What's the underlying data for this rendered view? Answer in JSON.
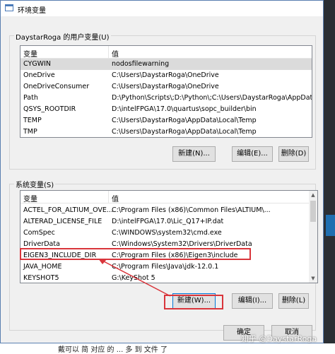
{
  "window": {
    "title": "环境变量"
  },
  "user_group": {
    "label": "DaystarRoga 的用户变量(U)",
    "columns": [
      "变量",
      "值"
    ],
    "rows": [
      {
        "name": "CYGWIN",
        "value": "nodosfilewarning"
      },
      {
        "name": "OneDrive",
        "value": "C:\\Users\\DaystarRoga\\OneDrive"
      },
      {
        "name": "OneDriveConsumer",
        "value": "C:\\Users\\DaystarRoga\\OneDrive"
      },
      {
        "name": "Path",
        "value": "D:\\Python\\Scripts\\;D:\\Python\\;C:\\Users\\DaystarRoga\\AppData..."
      },
      {
        "name": "QSYS_ROOTDIR",
        "value": "D:\\intelFPGA\\17.0\\quartus\\sopc_builder\\bin"
      },
      {
        "name": "TEMP",
        "value": "C:\\Users\\DaystarRoga\\AppData\\Local\\Temp"
      },
      {
        "name": "TMP",
        "value": "C:\\Users\\DaystarRoga\\AppData\\Local\\Temp"
      }
    ],
    "buttons": {
      "new": "新建(N)...",
      "edit": "编辑(E)...",
      "delete": "删除(D)"
    }
  },
  "system_group": {
    "label": "系统变量(S)",
    "columns": [
      "变量",
      "值"
    ],
    "rows": [
      {
        "name": "ACTEL_FOR_ALTIUM_OVE...",
        "value": "C:\\Program Files (x86)\\Common Files\\ALTIUM\\..."
      },
      {
        "name": "ALTERAD_LICENSE_FILE",
        "value": "D:\\intelFPGA\\17.0\\Lic_Q17+IP.dat"
      },
      {
        "name": "ComSpec",
        "value": "C:\\WINDOWS\\system32\\cmd.exe"
      },
      {
        "name": "DriverData",
        "value": "C:\\Windows\\System32\\Drivers\\DriverData"
      },
      {
        "name": "EIGEN3_INCLUDE_DIR",
        "value": "C:\\Program Files (x86)\\Eigen3\\include"
      },
      {
        "name": "JAVA_HOME",
        "value": "C:\\Program Files\\Java\\jdk-12.0.1"
      },
      {
        "name": "KEYSHOT5",
        "value": "G:\\KeyShot 5"
      }
    ],
    "buttons": {
      "new": "新建(W)...",
      "edit": "编辑(I)...",
      "delete": "删除(L)"
    }
  },
  "footer": {
    "ok": "确定",
    "cancel": "取消"
  },
  "watermark": "知乎 @DaystarRoga",
  "behind_text": "戴可以 简 对应 的 ... 多 到 文件 了",
  "colors": {
    "highlight": "#d9353b",
    "focus": "#0078d7"
  }
}
